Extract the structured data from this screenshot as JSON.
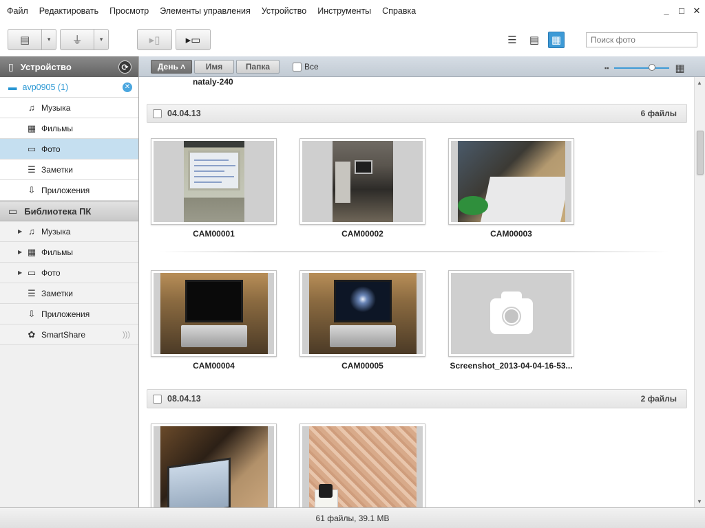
{
  "menu": [
    "Файл",
    "Редактировать",
    "Просмотр",
    "Элементы управления",
    "Устройство",
    "Инструменты",
    "Справка"
  ],
  "window_controls": {
    "minimize": "_",
    "maximize": "□",
    "close": "✕"
  },
  "toolbar": {
    "icons": {
      "backup": "list-icon",
      "usb": "usb-icon",
      "to_phone": "phone-transfer-icon",
      "to_pc": "pc-transfer-icon"
    },
    "dropdown_glyph": "▾",
    "views": [
      "list-view-icon",
      "detail-view-icon",
      "grid-view-icon"
    ],
    "active_view": "grid-view-icon"
  },
  "search": {
    "placeholder": "Поиск фото",
    "value": ""
  },
  "sidebar": {
    "device_header": "Устройство",
    "device_name": "avp0905 (1)",
    "device_items": [
      {
        "label": "Музыка",
        "icon": "♫"
      },
      {
        "label": "Фильмы",
        "icon": "▦"
      },
      {
        "label": "Фото",
        "icon": "▭",
        "selected": true
      },
      {
        "label": "Заметки",
        "icon": "☰"
      },
      {
        "label": "Приложения",
        "icon": "⇩"
      }
    ],
    "library_header": "Библиотека ПК",
    "library_items": [
      {
        "label": "Музыка",
        "icon": "♫",
        "expandable": true
      },
      {
        "label": "Фильмы",
        "icon": "▦",
        "expandable": true
      },
      {
        "label": "Фото",
        "icon": "▭",
        "expandable": true
      },
      {
        "label": "Заметки",
        "icon": "☰",
        "expandable": false
      },
      {
        "label": "Приложения",
        "icon": "⇩",
        "expandable": false
      },
      {
        "label": "SmartShare",
        "icon": "✿",
        "expandable": false
      }
    ]
  },
  "filterbar": {
    "sort_day": "День ˄",
    "sort_name": "Имя",
    "sort_folder": "Папка",
    "all_label": "Все",
    "zoom_level": 0.68
  },
  "content": {
    "previous_label": "nataly-240",
    "groups": [
      {
        "date": "04.04.13",
        "count": "6 файлы",
        "items": [
          "CAM00001",
          "CAM00002",
          "CAM00003",
          "CAM00004",
          "CAM00005",
          "Screenshot_2013-04-04-16-53..."
        ]
      },
      {
        "date": "08.04.13",
        "count": "2 файлы",
        "items": [
          "",
          ""
        ]
      }
    ]
  },
  "status": "61 файлы, 39.1 MB",
  "colors": {
    "accent": "#3d9ad6",
    "device_text": "#2a97d3",
    "selected_row": "#c5dff0"
  }
}
